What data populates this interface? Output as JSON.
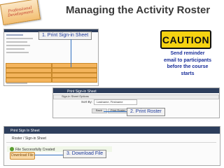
{
  "page_title": "Managing the Activity Roster",
  "badge_lines": [
    "Professional",
    "Development"
  ],
  "callouts": {
    "print_sign_in": "1. Print Sign-in Sheet",
    "print_roster": "2. Print Roster",
    "download_file": "3. Download File"
  },
  "caution": {
    "sign_text": "CAUTION",
    "message_lines": [
      "Send reminder",
      "email to participants",
      "before the  course",
      "starts"
    ]
  },
  "screens": {
    "print_dialog": {
      "header": "Print Sign-in Sheet",
      "section": "Sign-in Sheet Options",
      "sort_label": "Sort By:",
      "sort_value": "Lastname, Firstname",
      "buttons": [
        "Back",
        "Print Roster"
      ]
    },
    "download": {
      "header": "Print Sign In Sheet",
      "breadcrumb": "Roster / Sign-in Sheet",
      "success_text": "File Successfully Created",
      "button_label": "Download File"
    }
  },
  "colors": {
    "title": "#3a3a3a",
    "callout_text": "#1f3b9c",
    "caution_yellow": "#f6d312",
    "caution_text": "#1a2f9a",
    "nav_bar": "#2d3e5c",
    "accent_orange": "#f4b45c"
  }
}
